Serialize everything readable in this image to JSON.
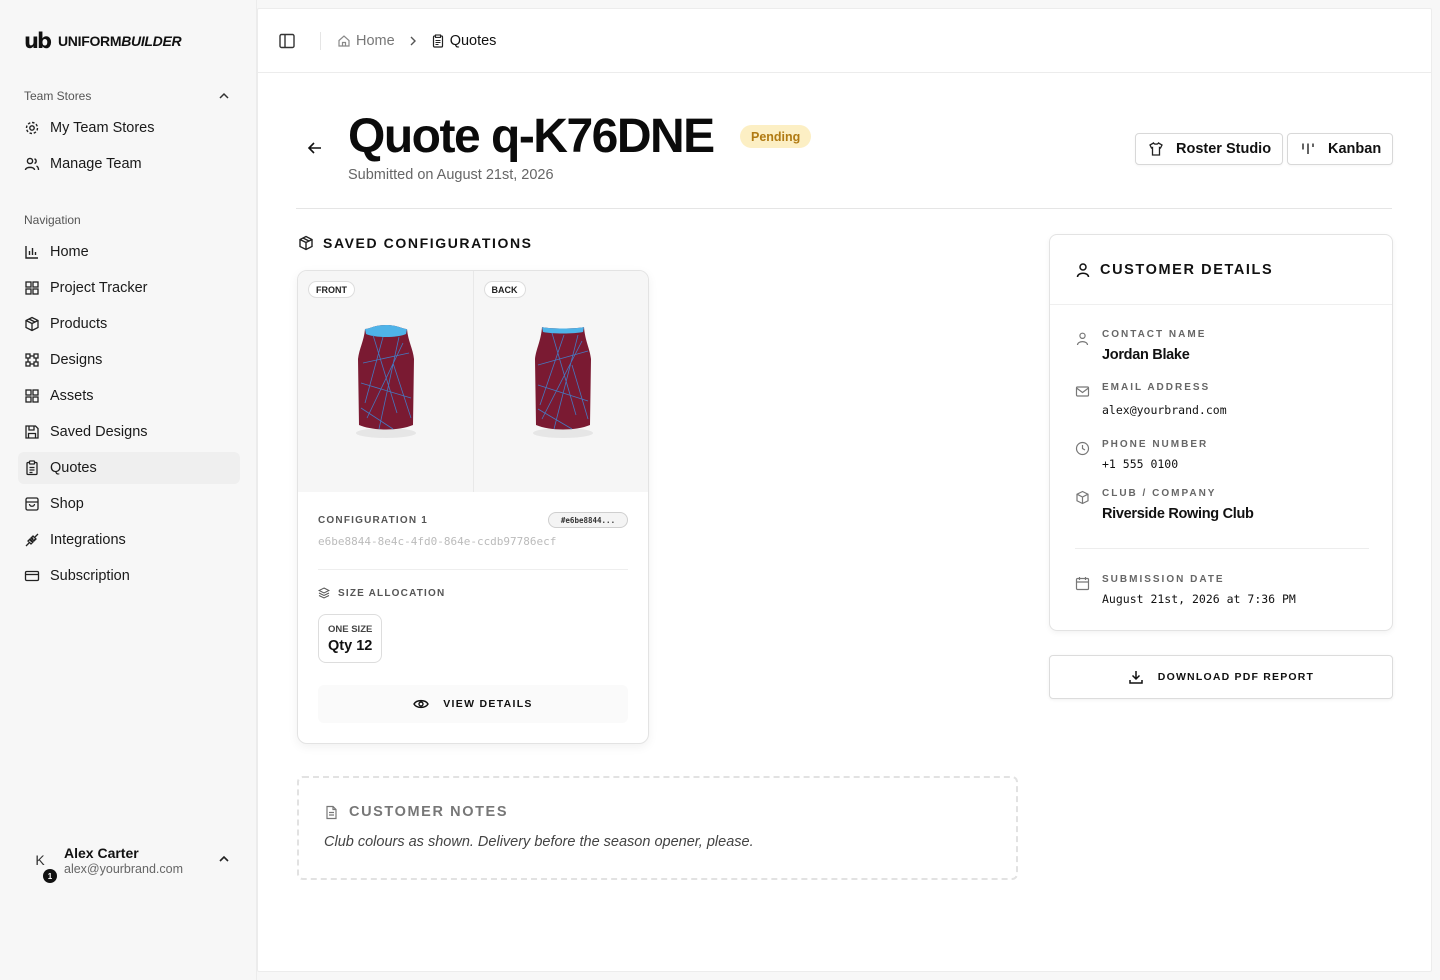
{
  "app": {
    "logo_mark": "ub",
    "logo_text_a": "UNIFORM",
    "logo_text_b": "BUILDER"
  },
  "sidebar": {
    "team_stores_label": "Team Stores",
    "team_items": [
      {
        "label": "My Team Stores",
        "icon": "gear-icon"
      },
      {
        "label": "Manage Team",
        "icon": "users-icon"
      }
    ],
    "navigation_label": "Navigation",
    "nav_items": [
      {
        "label": "Home",
        "icon": "bar-chart-icon"
      },
      {
        "label": "Project Tracker",
        "icon": "grid-icon"
      },
      {
        "label": "Products",
        "icon": "box-icon"
      },
      {
        "label": "Designs",
        "icon": "designs-icon"
      },
      {
        "label": "Assets",
        "icon": "assets-icon"
      },
      {
        "label": "Saved Designs",
        "icon": "save-icon"
      },
      {
        "label": "Quotes",
        "icon": "clipboard-icon",
        "active": true
      },
      {
        "label": "Shop",
        "icon": "shop-icon"
      },
      {
        "label": "Integrations",
        "icon": "plug-icon"
      },
      {
        "label": "Subscription",
        "icon": "card-icon"
      }
    ],
    "user": {
      "initial": "K",
      "badge": "1",
      "name": "Alex Carter",
      "email": "alex@yourbrand.com"
    }
  },
  "breadcrumb": {
    "home": "Home",
    "current": "Quotes"
  },
  "header": {
    "title": "Quote q-K76DNE",
    "status": "Pending",
    "subtitle": "Submitted on August 21st, 2026",
    "roster_button": "Roster Studio",
    "kanban_button": "Kanban"
  },
  "saved_configurations": {
    "heading": "SAVED CONFIGURATIONS",
    "config": {
      "front_label": "FRONT",
      "back_label": "BACK",
      "title": "CONFIGURATION 1",
      "pill": "#e6be8844...",
      "uuid": "e6be8844-8e4c-4fd0-864e-ccdb97786ecf",
      "size_heading": "SIZE ALLOCATION",
      "size_name": "ONE SIZE",
      "size_qty": "Qty 12",
      "view_details": "VIEW DETAILS"
    }
  },
  "notes": {
    "heading": "CUSTOMER NOTES",
    "text": "Club colours as shown. Delivery before the season opener, please."
  },
  "customer": {
    "heading": "CUSTOMER DETAILS",
    "contact_label": "CONTACT NAME",
    "contact_value": "Jordan Blake",
    "email_label": "EMAIL ADDRESS",
    "email_value": "alex@yourbrand.com",
    "phone_label": "PHONE NUMBER",
    "phone_value": "+1 555 0100",
    "club_label": "CLUB / COMPANY",
    "club_value": "Riverside Rowing Club",
    "date_label": "SUBMISSION DATE",
    "date_value": "August 21st, 2026 at 7:36 PM"
  },
  "download_button": "DOWNLOAD PDF REPORT",
  "colors": {
    "status_bg": "#fcefc4",
    "status_text": "#b07a12",
    "jersey_body": "#7a1a32",
    "jersey_trim": "#4fb3e8"
  }
}
